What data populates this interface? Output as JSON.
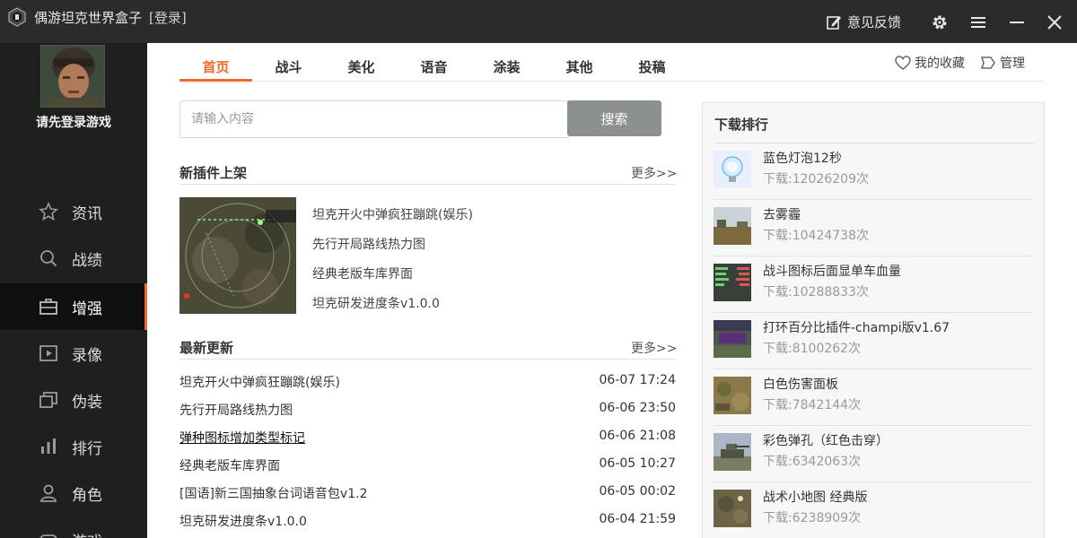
{
  "titlebar": {
    "title": "偶游坦克世界盒子",
    "login": "[登录]",
    "feedback": "意见反馈"
  },
  "sidebar": {
    "login_prompt": "请先登录游戏",
    "items": [
      {
        "label": "资讯",
        "icon": "star-icon"
      },
      {
        "label": "战绩",
        "icon": "search-icon"
      },
      {
        "label": "增强",
        "icon": "briefcase-icon"
      },
      {
        "label": "录像",
        "icon": "video-icon"
      },
      {
        "label": "伪装",
        "icon": "layers-icon"
      },
      {
        "label": "排行",
        "icon": "bar-chart-icon"
      },
      {
        "label": "角色",
        "icon": "user-icon"
      },
      {
        "label": "游戏",
        "icon": "gamepad-icon"
      }
    ],
    "active_item": "增强"
  },
  "tabs": [
    "首页",
    "战斗",
    "美化",
    "语音",
    "涂装",
    "其他",
    "投稿"
  ],
  "active_tab": "首页",
  "favorites": "我的收藏",
  "manage": "管理",
  "search": {
    "placeholder": "请输入内容",
    "button": "搜索"
  },
  "new_plugins": {
    "title": "新插件上架",
    "more": "更多>>",
    "items": [
      "坦克开火中弹疯狂蹦跳(娱乐)",
      "先行开局路线热力图",
      "经典老版车库界面",
      "坦克研发进度条v1.0.0"
    ]
  },
  "latest_updates": {
    "title": "最新更新",
    "more": "更多>>",
    "rows": [
      {
        "title": "坦克开火中弹疯狂蹦跳(娱乐)",
        "date": "06-07 17:24"
      },
      {
        "title": "先行开局路线热力图",
        "date": "06-06 23:50"
      },
      {
        "title": "弹种图标增加类型标记",
        "date": "06-06 21:08"
      },
      {
        "title": "经典老版车库界面",
        "date": "06-05 10:27"
      },
      {
        "title": "[国语]新三国抽象台词语音包v1.2",
        "date": "06-05 00:02"
      },
      {
        "title": "坦克研发进度条v1.0.0",
        "date": "06-04 21:59"
      }
    ]
  },
  "download_rank": {
    "title": "下载排行",
    "items": [
      {
        "name": "蓝色灯泡12秒",
        "downloads": "下载:12026209次"
      },
      {
        "name": "去雾霾",
        "downloads": "下载:10424738次"
      },
      {
        "name": "战斗图标后面显单车血量",
        "downloads": "下载:10288833次"
      },
      {
        "name": "打环百分比插件-champi版v1.67",
        "downloads": "下载:8100262次"
      },
      {
        "name": "白色伤害面板",
        "downloads": "下载:7842144次"
      },
      {
        "name": "彩色弹孔（红色击穿）",
        "downloads": "下载:6342063次"
      },
      {
        "name": "战术小地图 经典版",
        "downloads": "下载:6238909次"
      }
    ]
  },
  "colors": {
    "accent": "#f26a2a",
    "sidebar_bg": "#1f1f1f",
    "titlebar_bg": "#2b2b2b",
    "search_button": "#8c918e"
  }
}
